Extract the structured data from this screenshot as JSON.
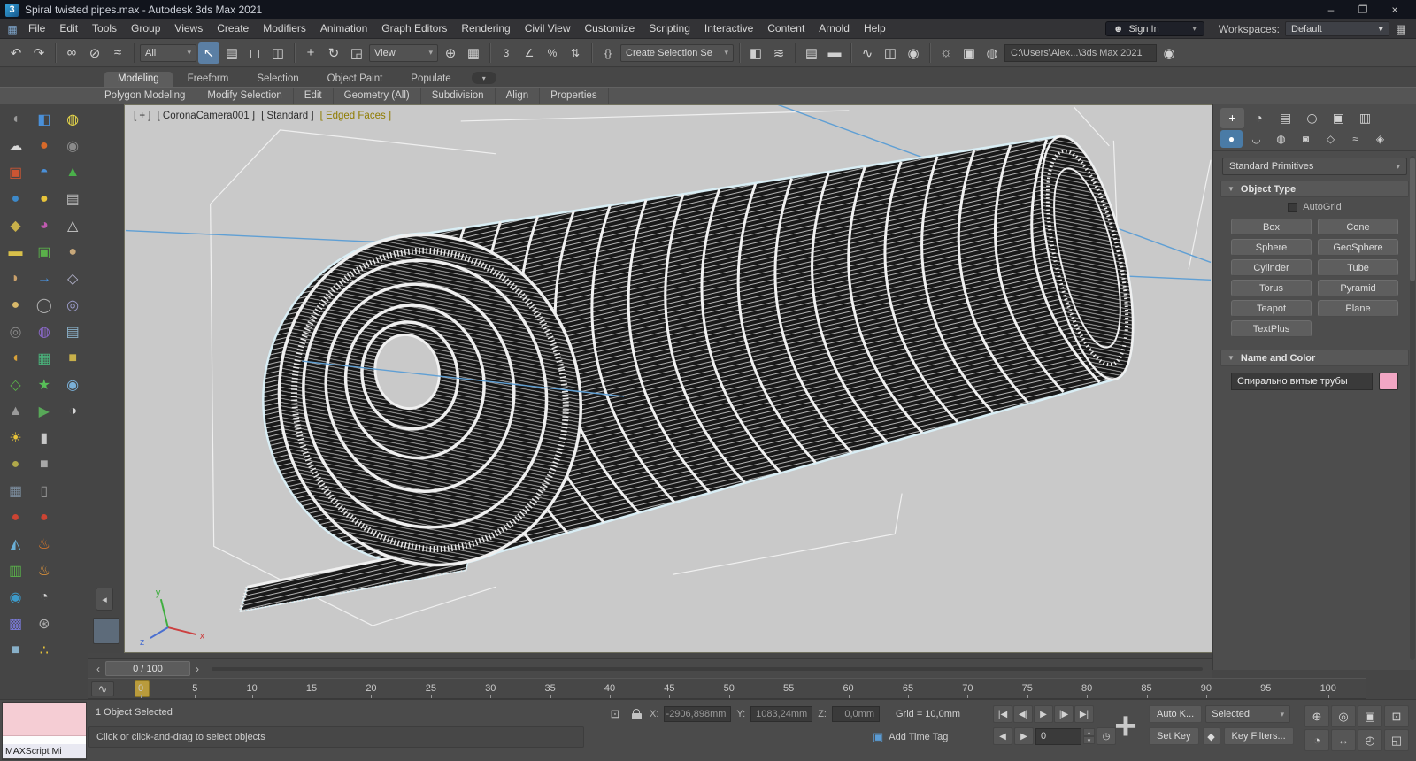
{
  "titlebar": {
    "app_initial": "3",
    "title": "Spiral twisted pipes.max - Autodesk 3ds Max 2021",
    "minimize": "–",
    "maximize": "❐",
    "close": "×"
  },
  "menubar": {
    "items": [
      "File",
      "Edit",
      "Tools",
      "Group",
      "Views",
      "Create",
      "Modifiers",
      "Animation",
      "Graph Editors",
      "Rendering",
      "Civil View",
      "Customize",
      "Scripting",
      "Interactive",
      "Content",
      "Arnold",
      "Help"
    ],
    "app_icon": "▦",
    "sign_in_icon": "☻",
    "sign_in": "Sign In",
    "workspaces_label": "Workspaces:",
    "workspaces_value": "Default",
    "end_icon": "▦"
  },
  "toolbar": {
    "filter_value": "All",
    "view_value": "View",
    "selection_set": "Create Selection Se",
    "path": "C:\\Users\\Alex...\\3ds Max 2021",
    "icons": {
      "undo": "↶",
      "redo": "↷",
      "link": "∞",
      "unlink": "⊘",
      "bind": "≈",
      "select": "↖",
      "byname": "▤",
      "marquee": "◻",
      "window": "◫",
      "move": "+",
      "rotate": "↻",
      "scale": "◲",
      "manipulate": "⊕",
      "keyboard": "▦",
      "snap": "3",
      "angle": "∠",
      "percent": "%",
      "spinner": "⇅",
      "sets": "{}",
      "mirror": "◧",
      "align": "≋",
      "layers": "▤",
      "ribbon": "▬",
      "curve": "∿",
      "schematic": "◫",
      "material": "◉",
      "rendersetup": "☼",
      "renderframe": "▣",
      "render": "◍",
      "render2": "◉"
    }
  },
  "ribbon": {
    "tabs": [
      "Modeling",
      "Freeform",
      "Selection",
      "Object Paint",
      "Populate"
    ],
    "config": "▾",
    "sections": [
      "Polygon Modeling",
      "Modify Selection",
      "Edit",
      "Geometry (All)",
      "Subdivision",
      "Align",
      "Properties"
    ]
  },
  "leftdock": {
    "col1": [
      {
        "g": "◖",
        "c": "#9a9a9a"
      },
      {
        "g": "☁",
        "c": "#d8d8d8"
      },
      {
        "g": "▣",
        "c": "#cc5533"
      },
      {
        "g": "●",
        "c": "#3d89c9"
      },
      {
        "g": "◆",
        "c": "#c8b04a"
      },
      {
        "g": "▬",
        "c": "#d8c04a"
      },
      {
        "g": "◗",
        "c": "#c9a06a"
      },
      {
        "g": "●",
        "c": "#d8b86a"
      },
      {
        "g": "◎",
        "c": "#8a8a8a"
      },
      {
        "g": "◖",
        "c": "#d8a23a"
      },
      {
        "g": "◇",
        "c": "#5ab04a"
      },
      {
        "g": "▲",
        "c": "#9a9a9a"
      },
      {
        "g": "☀",
        "c": "#e8c43a"
      },
      {
        "g": "●",
        "c": "#b0a84a"
      },
      {
        "g": "▦",
        "c": "#7a8a9a"
      },
      {
        "g": "●",
        "c": "#cc4433"
      },
      {
        "g": "◭",
        "c": "#6ab0d8"
      },
      {
        "g": "▥",
        "c": "#5ab04a"
      },
      {
        "g": "◉",
        "c": "#3d9ac9"
      },
      {
        "g": "▩",
        "c": "#7a7ad8"
      },
      {
        "g": "■",
        "c": "#88b0c8"
      }
    ],
    "col2": [
      {
        "g": "◧",
        "c": "#4a90d9"
      },
      {
        "g": "●",
        "c": "#d86a2a"
      },
      {
        "g": "◓",
        "c": "#4a90d9"
      },
      {
        "g": "●",
        "c": "#e8c43a"
      },
      {
        "g": "◕",
        "c": "#c05ab0"
      },
      {
        "g": "▣",
        "c": "#5ab04a"
      },
      {
        "g": "→",
        "c": "#4a90d9"
      },
      {
        "g": "◯",
        "c": "#b0b0b0"
      },
      {
        "g": "◍",
        "c": "#8a68c8"
      },
      {
        "g": "▦",
        "c": "#4ab07a"
      },
      {
        "g": "★",
        "c": "#58c058"
      },
      {
        "g": "▶",
        "c": "#58a858"
      },
      {
        "g": "▮",
        "c": "#c8c8c8"
      },
      {
        "g": "■",
        "c": "#a8a8a8"
      },
      {
        "g": "▯",
        "c": "#9a9a9a"
      },
      {
        "g": "●",
        "c": "#cc4433"
      },
      {
        "g": "♨",
        "c": "#e07a2a"
      },
      {
        "g": "♨",
        "c": "#e8983a"
      },
      {
        "g": "◔",
        "c": "#d8d8d8"
      },
      {
        "g": "⊛",
        "c": "#b0b0b0"
      },
      {
        "g": "∴",
        "c": "#e8c43a"
      }
    ],
    "col3": [
      {
        "g": "◍",
        "c": "#e8d84a"
      },
      {
        "g": "◉",
        "c": "#8a8a8a"
      },
      {
        "g": "▲",
        "c": "#4ab04a"
      },
      {
        "g": "▤",
        "c": "#b0b0b0"
      },
      {
        "g": "△",
        "c": "#c8c8c8"
      },
      {
        "g": "●",
        "c": "#c8a87a"
      },
      {
        "g": "◇",
        "c": "#b0b0c8"
      },
      {
        "g": "◎",
        "c": "#9a9ac8"
      },
      {
        "g": "▤",
        "c": "#8ab0c8"
      },
      {
        "g": "■",
        "c": "#c8b04a"
      },
      {
        "g": "◉",
        "c": "#7ab0d8"
      },
      {
        "g": "◑",
        "c": "#d8d8d8"
      }
    ]
  },
  "gutter": {
    "arrow": "◂"
  },
  "viewport": {
    "label_nav": "[ + ]",
    "label_pov": "[ CoronaCamera001 ]",
    "label_renderer": "[ Standard ]",
    "label_shading": "[ Edged Faces ]",
    "axis_x": "x",
    "axis_y": "y",
    "axis_z": "z"
  },
  "command_panel": {
    "tab_icons": {
      "create": "+",
      "modify": "◔",
      "hierarchy": "▤",
      "motion": "◴",
      "display": "▣",
      "utilities": "▥"
    },
    "sub_icons": {
      "geometry": "●",
      "shapes": "◡",
      "lights": "◍",
      "cameras": "◙",
      "helpers": "◇",
      "spacewarps": "≈",
      "systems": "◈"
    },
    "category": "Standard Primitives",
    "dd_arrow": "▾",
    "object_type_header": "Object Type",
    "rollout_arrow": "▼",
    "autogrid": "AutoGrid",
    "buttons": [
      "Box",
      "Cone",
      "Sphere",
      "GeoSphere",
      "Cylinder",
      "Tube",
      "Torus",
      "Pyramid",
      "Teapot",
      "Plane",
      "TextPlus"
    ],
    "name_color_header": "Name and Color",
    "object_name": "Спирально витые трубы",
    "object_color": "#f2a6c4"
  },
  "timeline": {
    "prev": "‹",
    "next": "›",
    "value": "0 / 100",
    "curve_btn": "∿",
    "ticks": [
      "0",
      "5",
      "10",
      "15",
      "20",
      "25",
      "30",
      "35",
      "40",
      "45",
      "50",
      "55",
      "60",
      "65",
      "70",
      "75",
      "80",
      "85",
      "90",
      "95",
      "100"
    ]
  },
  "statusbar": {
    "maxscript": "MAXScript Mi",
    "selected": "1 Object Selected",
    "prompt": "Click or click-and-drag to select objects",
    "isolate_icon": "⊡",
    "x_label": "X:",
    "x_value": "-2906,898mm",
    "y_label": "Y:",
    "y_value": "1083,24mm",
    "z_label": "Z:",
    "z_value": "0,0mm",
    "grid": "Grid = 10,0mm",
    "timetag_icon": "▣",
    "add_time_tag": "Add Time Tag",
    "transport": {
      "start": "|◀",
      "prev": "◀|",
      "play": "▶",
      "next": "|▶",
      "end": "▶|"
    },
    "transport2": {
      "prev_key": "◀",
      "next_key": "▶",
      "time_config": "◷"
    },
    "frame": "0",
    "spin_up": "▴",
    "spin_down": "▾",
    "big_plus": "+",
    "auto_key": "Auto K...",
    "set_key": "Set Key",
    "key_mini": "◆",
    "selected_filter": "Selected",
    "key_filters": "Key Filters...",
    "nav": {
      "zoom": "⊕",
      "zoom_all": "◎",
      "zoom_extents": "▣",
      "zoom_region": "⊡",
      "fov": "◔",
      "pan": "↔",
      "orbit": "◴",
      "maximize": "◱"
    }
  }
}
